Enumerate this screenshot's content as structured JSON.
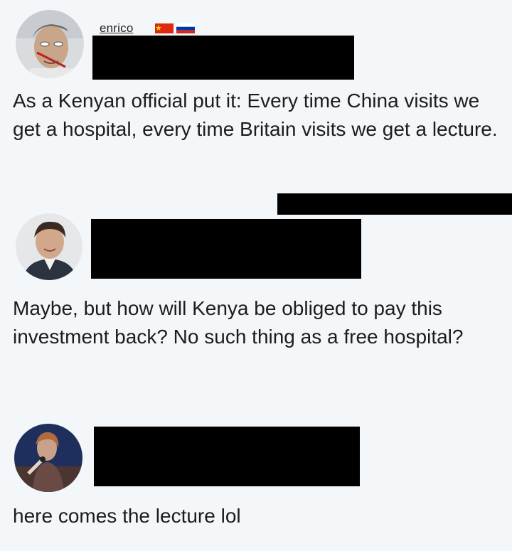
{
  "comments": [
    {
      "username": "enrico",
      "flags": [
        "china-flag-icon",
        "russia-flag-icon"
      ],
      "text": "As a Kenyan official put it: Every time China visits we get a hospital, every time Britain visits we get a lecture."
    },
    {
      "username": "",
      "text": "Maybe, but how will Kenya be obliged to pay this investment back? No such thing as a free hospital?"
    },
    {
      "username": "",
      "text": "here comes the lecture lol"
    }
  ],
  "colors": {
    "background": "#f3f7fa",
    "text": "#1c1c1c",
    "redaction": "#000000"
  }
}
